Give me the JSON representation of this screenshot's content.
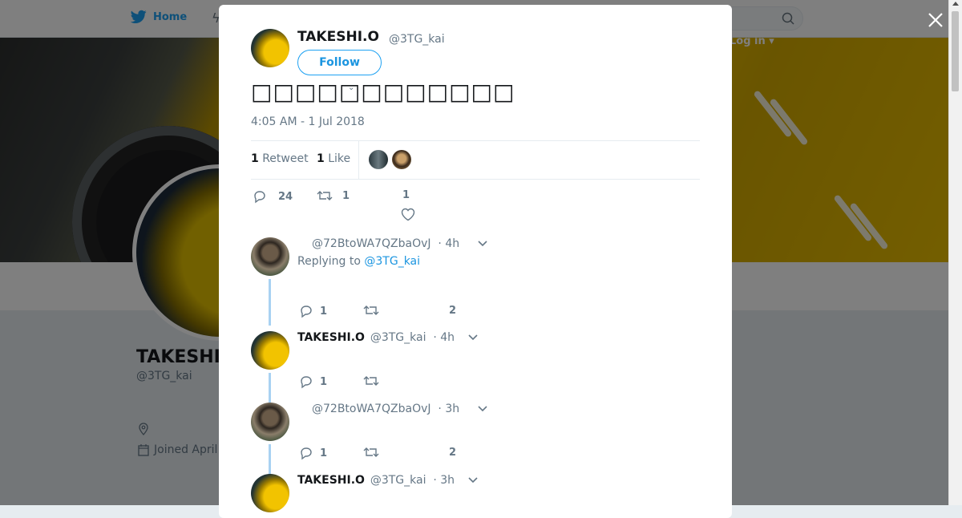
{
  "background": {
    "nav": {
      "home_label": "Home",
      "login_label": "Log in ▾"
    },
    "profile": {
      "name": "TAKESHI",
      "handle": "@3TG_kai",
      "joined": "Joined April"
    }
  },
  "tweet": {
    "author": {
      "name": "TAKESHI.O",
      "handle": "@3TG_kai"
    },
    "follow_label": "Follow",
    "text": "□□□□□□□□□□□□",
    "timestamp": "4:05 AM - 1 Jul 2018",
    "stats": {
      "retweets": "1",
      "retweets_label": "Retweet",
      "likes": "1",
      "likes_label": "Like"
    },
    "actions": {
      "replies": "24",
      "retweets": "1",
      "likes": "1"
    }
  },
  "replies": [
    {
      "name": "",
      "handle": "@72BtoWA7QZbaOvJ",
      "time": "· 4h",
      "replying_prefix": "Replying to",
      "replying_to": "@3TG_kai",
      "reply_count": "1",
      "like_count": "2"
    },
    {
      "name": "TAKESHI.O",
      "handle": "@3TG_kai",
      "time": "· 4h",
      "reply_count": "1"
    },
    {
      "name": "",
      "handle": "@72BtoWA7QZbaOvJ",
      "time": "· 3h",
      "reply_count": "1",
      "like_count": "2"
    },
    {
      "name": "TAKESHI.O",
      "handle": "@3TG_kai",
      "time": "· 3h"
    }
  ],
  "colors": {
    "accent": "#1da1f2",
    "link": "#1b95e0",
    "muted": "#657786",
    "thread": "#a9d2f2",
    "banner": "#f0c400"
  },
  "icons": [
    "twitter-bird-icon",
    "search-icon",
    "close-icon",
    "reply-icon",
    "retweet-icon",
    "heart-icon",
    "chevron-down-icon",
    "location-icon",
    "calendar-icon"
  ]
}
